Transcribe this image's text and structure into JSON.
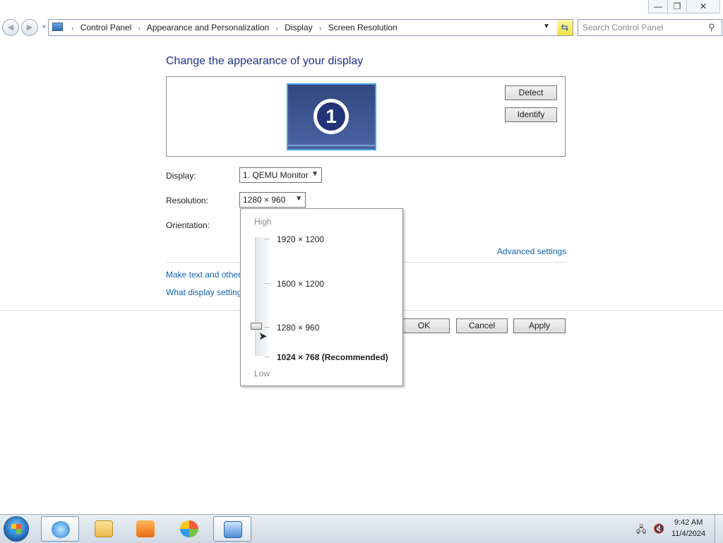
{
  "window": {
    "minimize_glyph": "—",
    "maximize_glyph": "❐",
    "close_glyph": "✕"
  },
  "nav": {
    "back_icon": "arrow-left-icon",
    "forward_icon": "arrow-right-icon",
    "breadcrumbs": [
      "Control Panel",
      "Appearance and Personalization",
      "Display",
      "Screen Resolution"
    ],
    "search_placeholder": "Search Control Panel"
  },
  "main": {
    "title": "Change the appearance of your display",
    "monitor_number": "1",
    "detect_label": "Detect",
    "identify_label": "Identify",
    "display_label": "Display:",
    "display_value": "1. QEMU Monitor",
    "resolution_label": "Resolution:",
    "resolution_value": "1280 × 960",
    "orientation_label": "Orientation:",
    "advanced_link": "Advanced settings",
    "link_text_size": "Make text and other",
    "link_settings": "What display setting",
    "ok_label": "OK",
    "cancel_label": "Cancel",
    "apply_label": "Apply"
  },
  "resolution_popup": {
    "high_label": "High",
    "low_label": "Low",
    "options": [
      "1920 × 1200",
      "1600 × 1200",
      "1280 × 960",
      "1024 × 768 (Recommended)"
    ],
    "selected": "1280 × 960"
  },
  "taskbar": {
    "apps": [
      "internet-explorer-icon",
      "folder-icon",
      "media-player-icon",
      "windows-media-center-icon",
      "control-panel-icon"
    ],
    "clock_time": "9:42 AM",
    "clock_date": "11/4/2024"
  },
  "colors": {
    "link": "#1060b0",
    "title": "#1e3287",
    "monitor_tile": "#3a5596"
  }
}
